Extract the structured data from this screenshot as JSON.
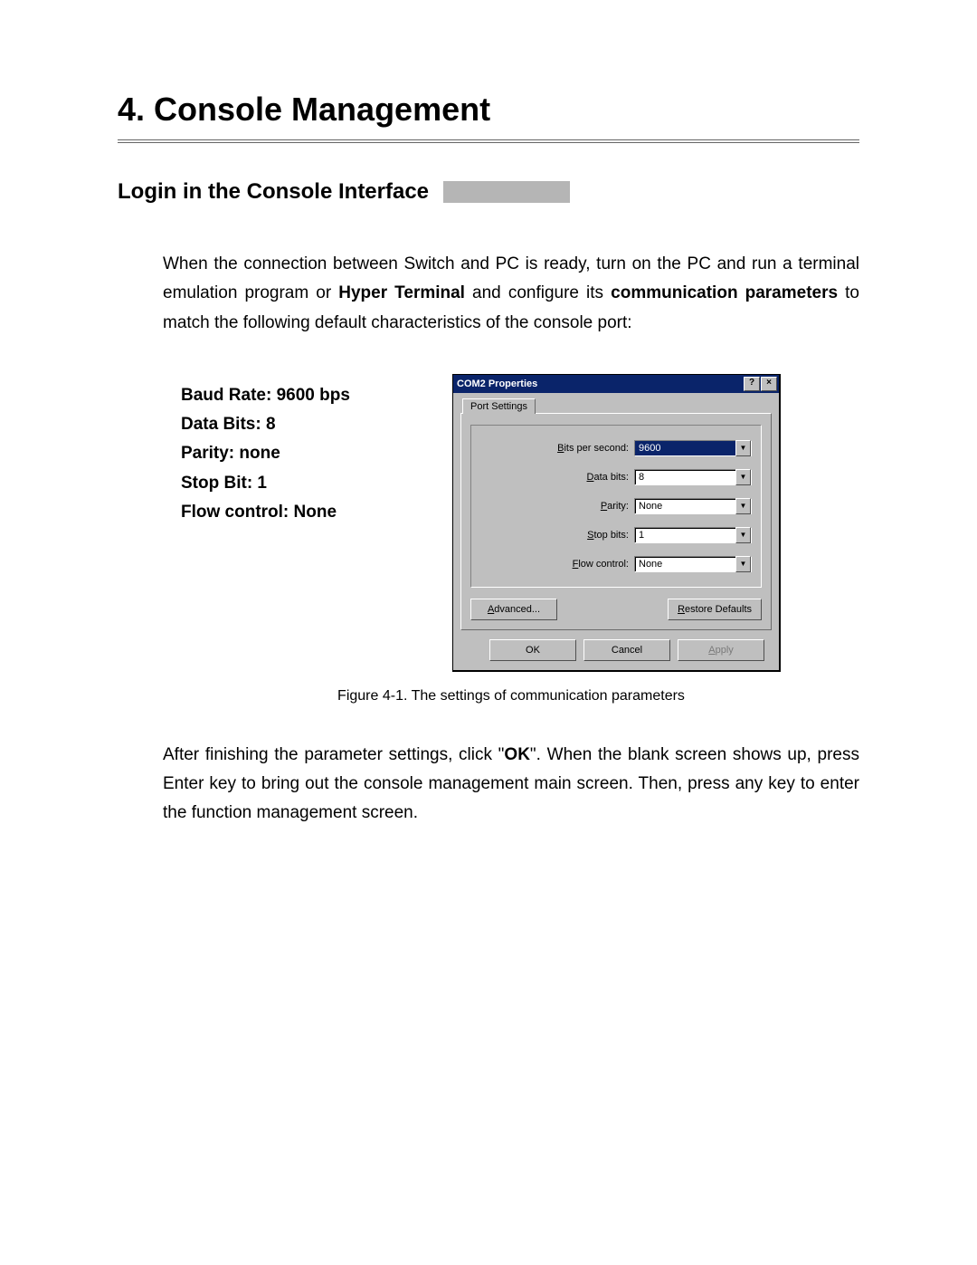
{
  "heading": "4. Console Management",
  "section_title": "Login in the Console Interface",
  "intro_parts": {
    "p1": "When the connection between Switch and PC is ready, turn on the PC and run a terminal emulation program or ",
    "bold1": "Hyper Terminal",
    "p2": " and configure its ",
    "bold2": "communication parameters",
    "p3": " to match the following default characteristics of the console port:"
  },
  "params": [
    "Baud Rate: 9600 bps",
    "Data Bits: 8",
    "Parity: none",
    "Stop Bit: 1",
    "Flow control: None"
  ],
  "dialog": {
    "title": "COM2 Properties",
    "help_btn": "?",
    "close_btn": "×",
    "tab": "Port Settings",
    "fields": {
      "bits_per_second": {
        "label_pre": "",
        "label_u": "B",
        "label_post": "its per second:",
        "value": "9600"
      },
      "data_bits": {
        "label_pre": "",
        "label_u": "D",
        "label_post": "ata bits:",
        "value": "8"
      },
      "parity": {
        "label_pre": "",
        "label_u": "P",
        "label_post": "arity:",
        "value": "None"
      },
      "stop_bits": {
        "label_pre": "",
        "label_u": "S",
        "label_post": "top bits:",
        "value": "1"
      },
      "flow_control": {
        "label_pre": "",
        "label_u": "F",
        "label_post": "low control:",
        "value": "None"
      }
    },
    "advanced_pre": "",
    "advanced_u": "A",
    "advanced_post": "dvanced...",
    "restore_pre": "",
    "restore_u": "R",
    "restore_post": "estore Defaults",
    "ok": "OK",
    "cancel": "Cancel",
    "apply_pre": "",
    "apply_u": "A",
    "apply_post": "pply"
  },
  "caption": "Figure 4-1. The settings of communication parameters",
  "outro_parts": {
    "p1": "After finishing the parameter settings, click \"",
    "bold": "OK",
    "p2": "\". When the blank screen shows up, press Enter key to bring out the console management main screen. Then, press any key to enter the function management screen."
  }
}
